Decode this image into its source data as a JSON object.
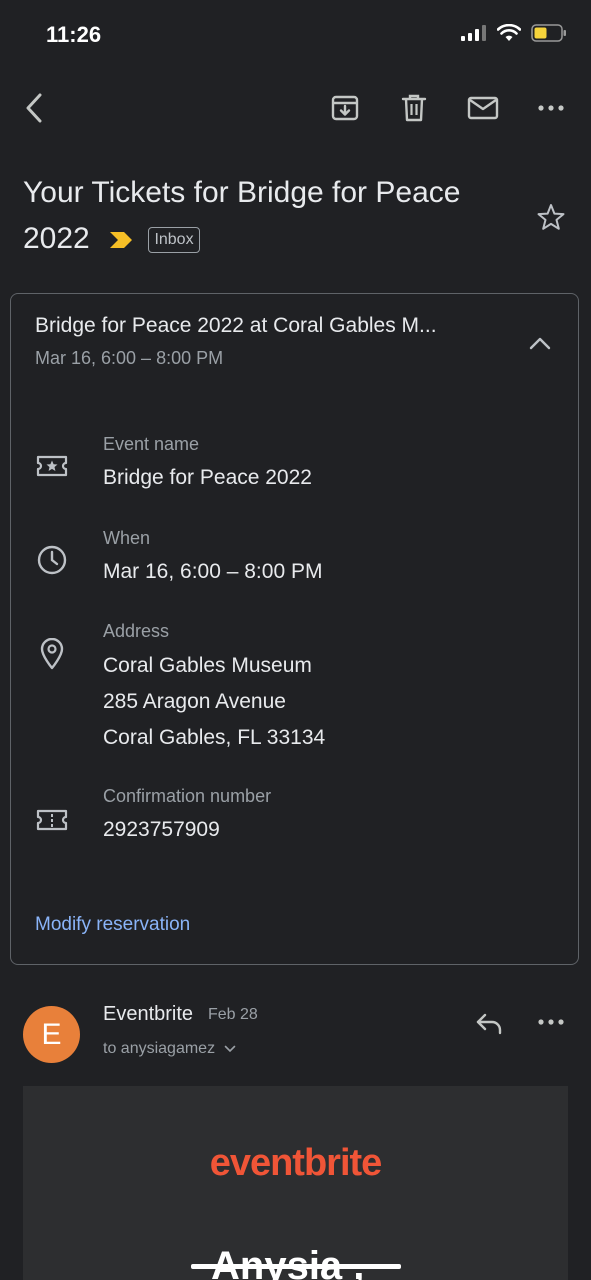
{
  "status_bar": {
    "time": "11:26"
  },
  "toolbar": {
    "back_icon": "chevron-left-icon",
    "archive_icon": "archive-icon",
    "delete_icon": "trash-icon",
    "mark_unread_icon": "mail-icon",
    "more_icon": "more-horizontal-icon"
  },
  "email": {
    "subject": "Your Tickets for Bridge for Peace 2022",
    "label": "Inbox",
    "important_color": "#f6bf26"
  },
  "event_card": {
    "title": "Bridge for Peace 2022 at Coral Gables M...",
    "subtitle": "Mar 16, 6:00 – 8:00 PM",
    "rows": [
      {
        "icon": "ticket-star-icon",
        "label": "Event name",
        "value": "Bridge for Peace 2022"
      },
      {
        "icon": "clock-icon",
        "label": "When",
        "value": "Mar 16, 6:00 – 8:00 PM"
      },
      {
        "icon": "location-pin-icon",
        "label": "Address",
        "lines": [
          "Coral Gables Museum",
          "285 Aragon Avenue",
          "Coral Gables, FL 33134"
        ]
      },
      {
        "icon": "ticket-icon",
        "label": "Confirmation number",
        "value": "2923757909"
      }
    ],
    "action": "Modify reservation"
  },
  "message": {
    "avatar_letter": "E",
    "avatar_color": "#e8803a",
    "sender": "Eventbrite",
    "date": "Feb 28",
    "recipient": "to anysiagamez",
    "body_brand": "eventbrite",
    "body_greeting": "Anysia ,"
  }
}
